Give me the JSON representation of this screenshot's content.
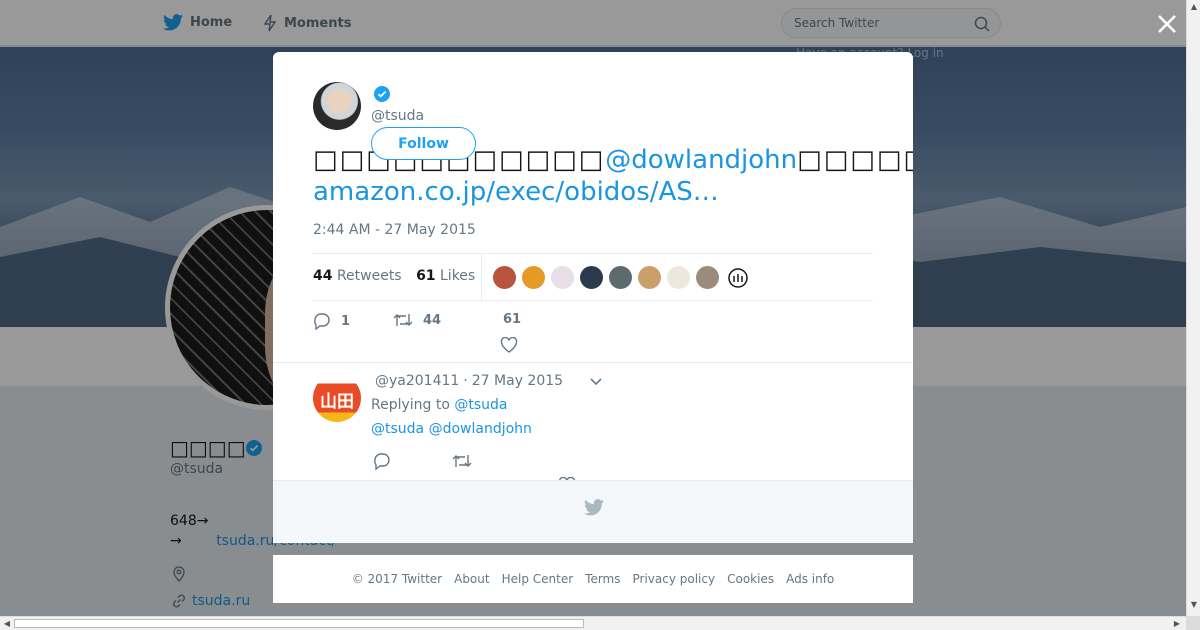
{
  "nav": {
    "home_label": "Home",
    "moments_label": "Moments",
    "search_placeholder": "Search Twitter",
    "login_text": "Have an account? Log in"
  },
  "profile": {
    "name": "□□□□",
    "handle": "@tsuda",
    "bio_line1": "648→",
    "bio_line2": "→",
    "bio_link": "tsuda.ru/contact/",
    "website": "tsuda.ru"
  },
  "tweet": {
    "handle": "@tsuda",
    "follow_label": "Follow",
    "text_glyphs_before": "□□□□□□□□□□□",
    "mention": "@dowlandjohn",
    "text_glyphs_after": "□□□□□□□□□□□□□□□□□□□□□□□□□□□□□□□□□",
    "link": "amazon.co.jp/exec/obidos/AS…",
    "timestamp": "2:44 AM - 27 May 2015",
    "retweet_count": "44",
    "retweets_label": "Retweets",
    "like_count": "61",
    "likes_label": "Likes",
    "reply_action_count": "1",
    "retweet_action_count": "44",
    "like_action_count": "61",
    "liker_avatar_colors": [
      "#b8553e",
      "#e59a26",
      "#e8dfe8",
      "#2c3a4e",
      "#5e6b6e",
      "#c9a06b",
      "#ece8de",
      "#9b8b7d"
    ]
  },
  "reply": {
    "avatar_text": "山田",
    "handle": "@ya201411",
    "date": "27 May 2015",
    "replying_label": "Replying to",
    "replying_to": "@tsuda",
    "text": "@tsuda @dowlandjohn"
  },
  "footer": {
    "links": [
      "© 2017 Twitter",
      "About",
      "Help Center",
      "Terms",
      "Privacy policy",
      "Cookies",
      "Ads info"
    ]
  },
  "colors": {
    "accent": "#1b95e0",
    "verified": "#1da1f2"
  }
}
